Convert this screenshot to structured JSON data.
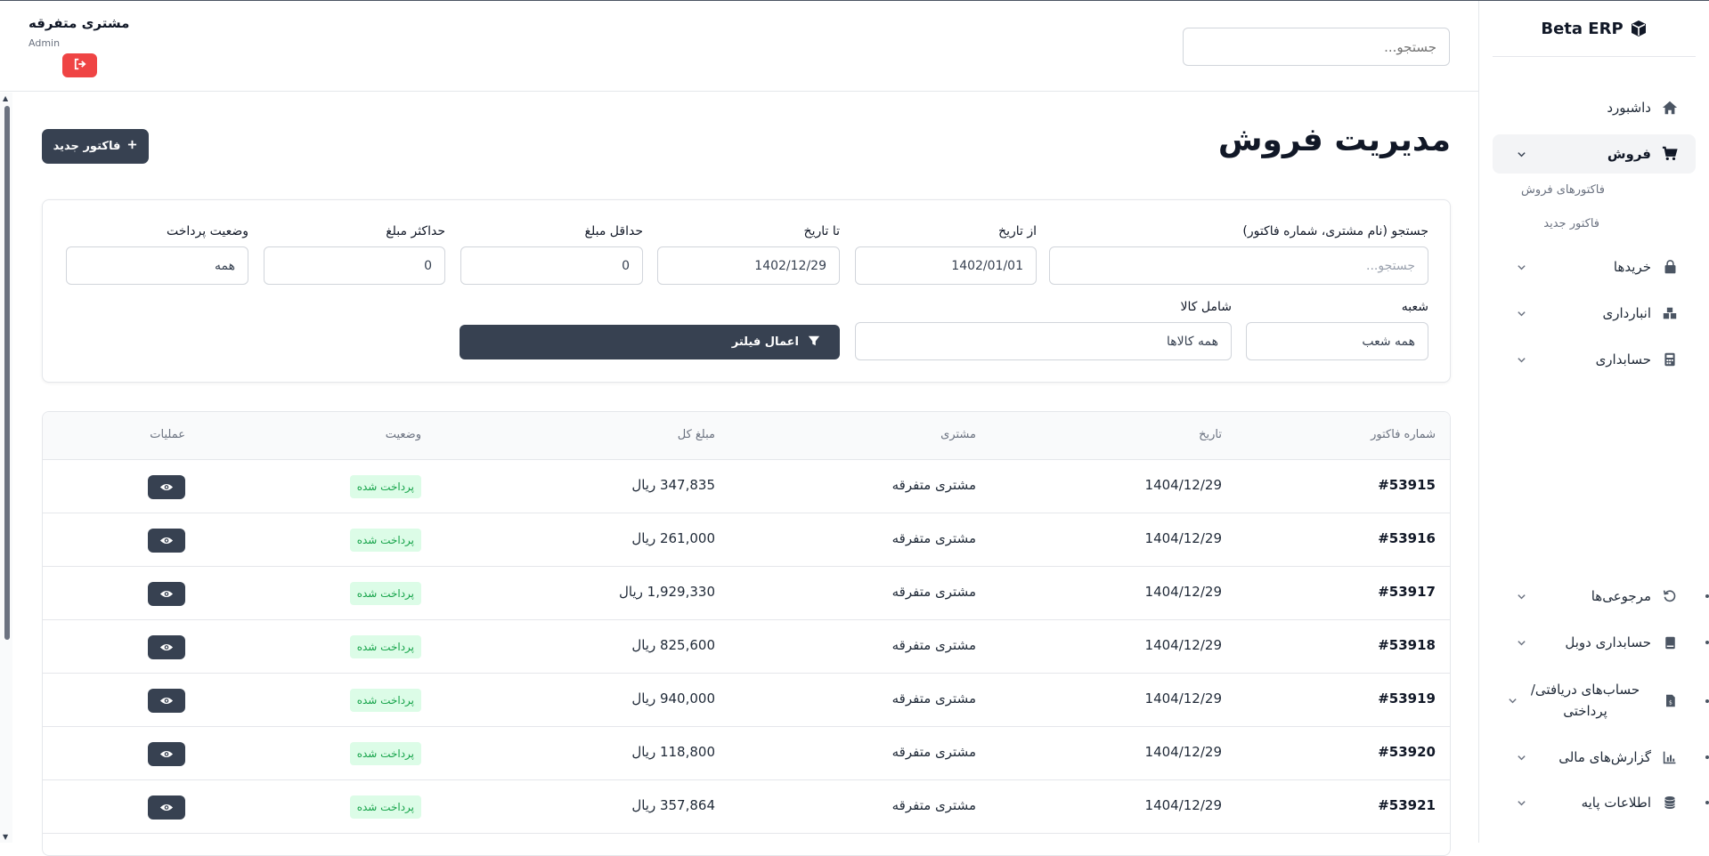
{
  "brand": {
    "name": "Beta ERP"
  },
  "sidebar": {
    "items": [
      {
        "label": "داشبورد",
        "icon": "home-icon"
      },
      {
        "label": "فروش",
        "icon": "cart-icon"
      },
      {
        "label": "خریدها",
        "icon": "bag-icon"
      },
      {
        "label": "انبارداری",
        "icon": "warehouse-icon"
      },
      {
        "label": "حسابداری",
        "icon": "calculator-icon"
      },
      {
        "label": "مرجوعی‌ها",
        "icon": "undo-icon"
      },
      {
        "label": "حسابداری دوبل",
        "icon": "book-icon"
      },
      {
        "label": "حساب‌های دریافتی/ پرداختی",
        "icon": "invoice-icon"
      },
      {
        "label": "گزارش‌های مالی",
        "icon": "chart-icon"
      },
      {
        "label": "اطلاعات پایه",
        "icon": "database-icon"
      }
    ],
    "sub_items": [
      {
        "label": "فاکتورهای فروش"
      },
      {
        "label": "فاکتور جدید"
      }
    ]
  },
  "topbar": {
    "search_placeholder": "جستجو...",
    "user_name": "مشتری متفرقه",
    "user_role": "Admin"
  },
  "page": {
    "title": "مدیریت فروش",
    "new_invoice_label": "فاکتور جدید"
  },
  "filters": {
    "search_label": "جستجو (نام مشتری، شماره فاکتور)",
    "search_placeholder": "جستجو...",
    "from_date_label": "از تاریخ",
    "from_date_value": "1402/01/01",
    "to_date_label": "تا تاریخ",
    "to_date_value": "1402/12/29",
    "min_amount_label": "حداقل مبلغ",
    "min_amount_value": "0",
    "max_amount_label": "حداکثر مبلغ",
    "max_amount_value": "0",
    "payment_status_label": "وضعیت پرداخت",
    "payment_status_value": "همه",
    "branch_label": "شعبه",
    "branch_value": "همه شعب",
    "product_label": "شامل کالا",
    "product_value": "همه کالاها",
    "apply_label": "اعمال فیلتر"
  },
  "table": {
    "headers": {
      "invoice": "شماره فاکتور",
      "date": "تاریخ",
      "customer": "مشتری",
      "amount": "مبلغ کل",
      "status": "وضعیت",
      "actions": "عملیات"
    },
    "rows": [
      {
        "invoice": "#53915",
        "date": "1404/12/29",
        "customer": "مشتری متفرقه",
        "amount": "347,835 ریال",
        "status": "پرداخت شده"
      },
      {
        "invoice": "#53916",
        "date": "1404/12/29",
        "customer": "مشتری متفرقه",
        "amount": "261,000 ریال",
        "status": "پرداخت شده"
      },
      {
        "invoice": "#53917",
        "date": "1404/12/29",
        "customer": "مشتری متفرقه",
        "amount": "1,929,330 ریال",
        "status": "پرداخت شده"
      },
      {
        "invoice": "#53918",
        "date": "1404/12/29",
        "customer": "مشتری متفرقه",
        "amount": "825,600 ریال",
        "status": "پرداخت شده"
      },
      {
        "invoice": "#53919",
        "date": "1404/12/29",
        "customer": "مشتری متفرقه",
        "amount": "940,000 ریال",
        "status": "پرداخت شده"
      },
      {
        "invoice": "#53920",
        "date": "1404/12/29",
        "customer": "مشتری متفرقه",
        "amount": "118,800 ریال",
        "status": "پرداخت شده"
      },
      {
        "invoice": "#53921",
        "date": "1404/12/29",
        "customer": "مشتری متفرقه",
        "amount": "357,864 ریال",
        "status": "پرداخت شده"
      }
    ]
  },
  "colors": {
    "primary_dark": "#374151",
    "danger": "#ef4444",
    "success_bg": "#dcfce7",
    "success_text": "#16a34a"
  }
}
